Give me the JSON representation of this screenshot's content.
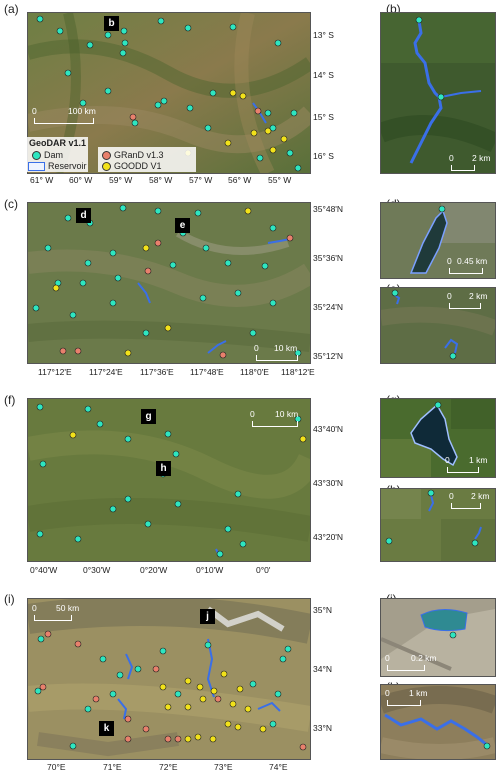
{
  "colors": {
    "dam": "#2ee6c0",
    "grand": "#e8806c",
    "goodd": "#f2e21a",
    "reservoir": "#3a6fe8"
  },
  "panels": {
    "a": {
      "label": "(a)",
      "marker": "b",
      "lat": [
        "13° S",
        "14° S",
        "15° S",
        "16° S"
      ],
      "lon": [
        "61° W",
        "60° W",
        "59° W",
        "58° W",
        "57° W",
        "56° W",
        "55° W"
      ],
      "scale": {
        "zero": "0",
        "value": "100 km"
      }
    },
    "b": {
      "label": "(b)",
      "scale": {
        "zero": "0",
        "value": "2 km"
      }
    },
    "c": {
      "label": "(c)",
      "markers": [
        "d",
        "e"
      ],
      "lat": [
        "35°48'N",
        "35°36'N",
        "35°24'N",
        "35°12'N"
      ],
      "lon": [
        "117°12'E",
        "117°24'E",
        "117°36'E",
        "117°48'E",
        "118°0'E",
        "118°12'E"
      ],
      "scale": {
        "zero": "0",
        "value": "10 km"
      }
    },
    "d": {
      "label": "(d)",
      "scale": {
        "zero": "0",
        "value": "0.45 km"
      }
    },
    "e": {
      "label": "(e)",
      "scale": {
        "zero": "0",
        "value": "2 km"
      }
    },
    "f": {
      "label": "(f)",
      "markers": [
        "g",
        "h"
      ],
      "lat": [
        "43°40'N",
        "43°30'N",
        "43°20'N"
      ],
      "lon": [
        "0°40'W",
        "0°30'W",
        "0°20'W",
        "0°10'W",
        "0°0'"
      ],
      "scale": {
        "zero": "0",
        "value": "10 km"
      }
    },
    "g": {
      "label": "(g)",
      "scale": {
        "zero": "0",
        "value": "1 km"
      }
    },
    "h": {
      "label": "(h)",
      "scale": {
        "zero": "0",
        "value": "2 km"
      }
    },
    "i": {
      "label": "(i)",
      "markers": [
        "j",
        "k"
      ],
      "lat": [
        "35°N",
        "34°N",
        "33°N"
      ],
      "lon": [
        "70°E",
        "71°E",
        "72°E",
        "73°E",
        "74°E"
      ],
      "scale": {
        "zero": "0",
        "value": "50 km"
      }
    },
    "j": {
      "label": "(j)",
      "scale": {
        "zero": "0",
        "value": "0.2 km"
      }
    },
    "k": {
      "label": "(k)",
      "scale": {
        "zero": "0",
        "value": "1 km"
      }
    }
  },
  "legend": {
    "title": "GeoDAR v1.1",
    "dam": "Dam",
    "reservoir": "Reservoir",
    "grand": "GRanD v1.3",
    "goodd": "GOODD V1"
  }
}
